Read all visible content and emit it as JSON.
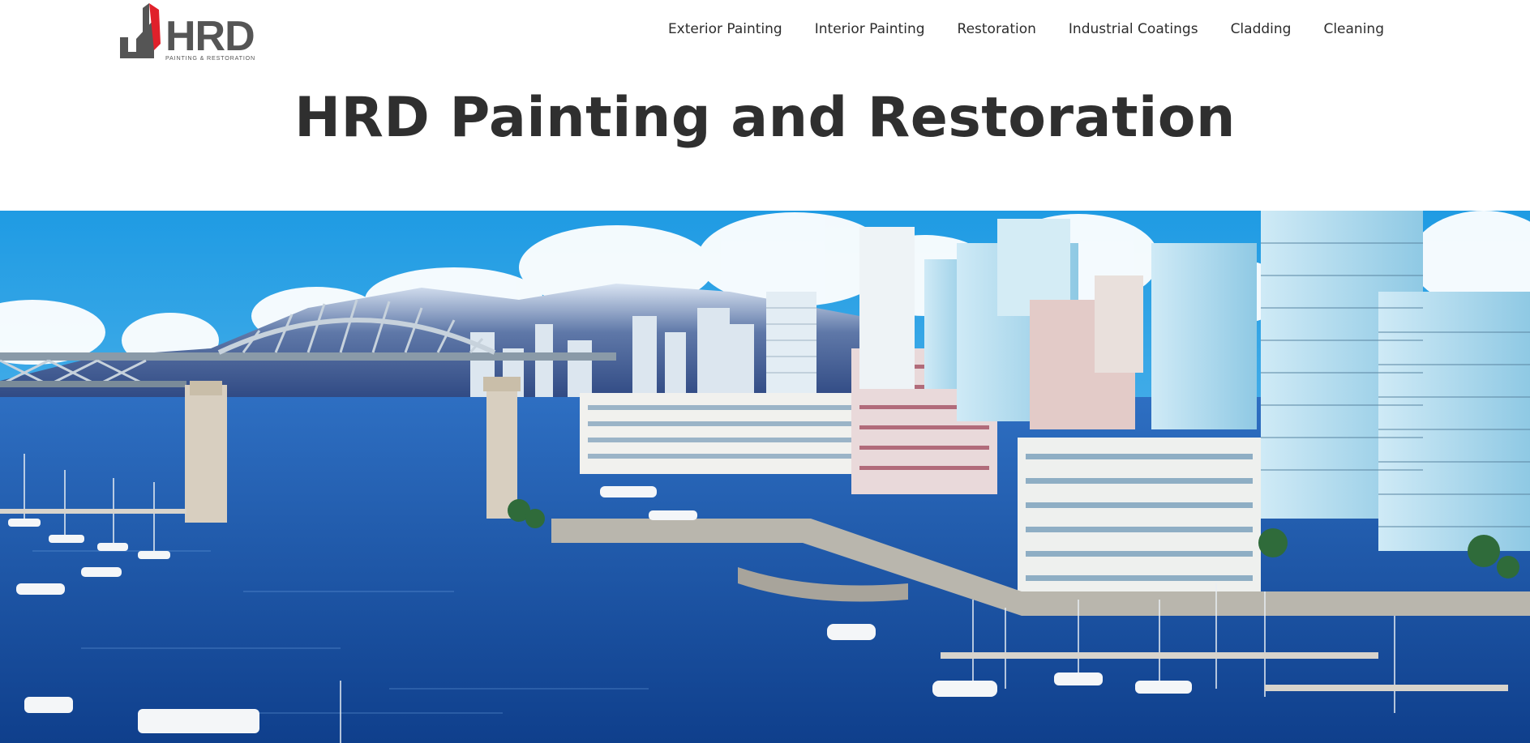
{
  "header": {
    "logo": {
      "text": "HRD",
      "tagline": "PAINTING & RESTORATION",
      "colors": {
        "dark": "#555555",
        "accent": "#e0202a"
      }
    },
    "nav": [
      {
        "label": "Exterior Painting"
      },
      {
        "label": "Interior Painting"
      },
      {
        "label": "Restoration"
      },
      {
        "label": "Industrial Coatings"
      },
      {
        "label": "Cladding"
      },
      {
        "label": "Cleaning"
      }
    ]
  },
  "main": {
    "title": "HRD Painting and Restoration",
    "hero": {
      "icon": "vancouver-skyline-image"
    }
  },
  "colors": {
    "sky": "#35a8e6",
    "water": "#1a5fb8",
    "text": "#2f2f2f"
  }
}
